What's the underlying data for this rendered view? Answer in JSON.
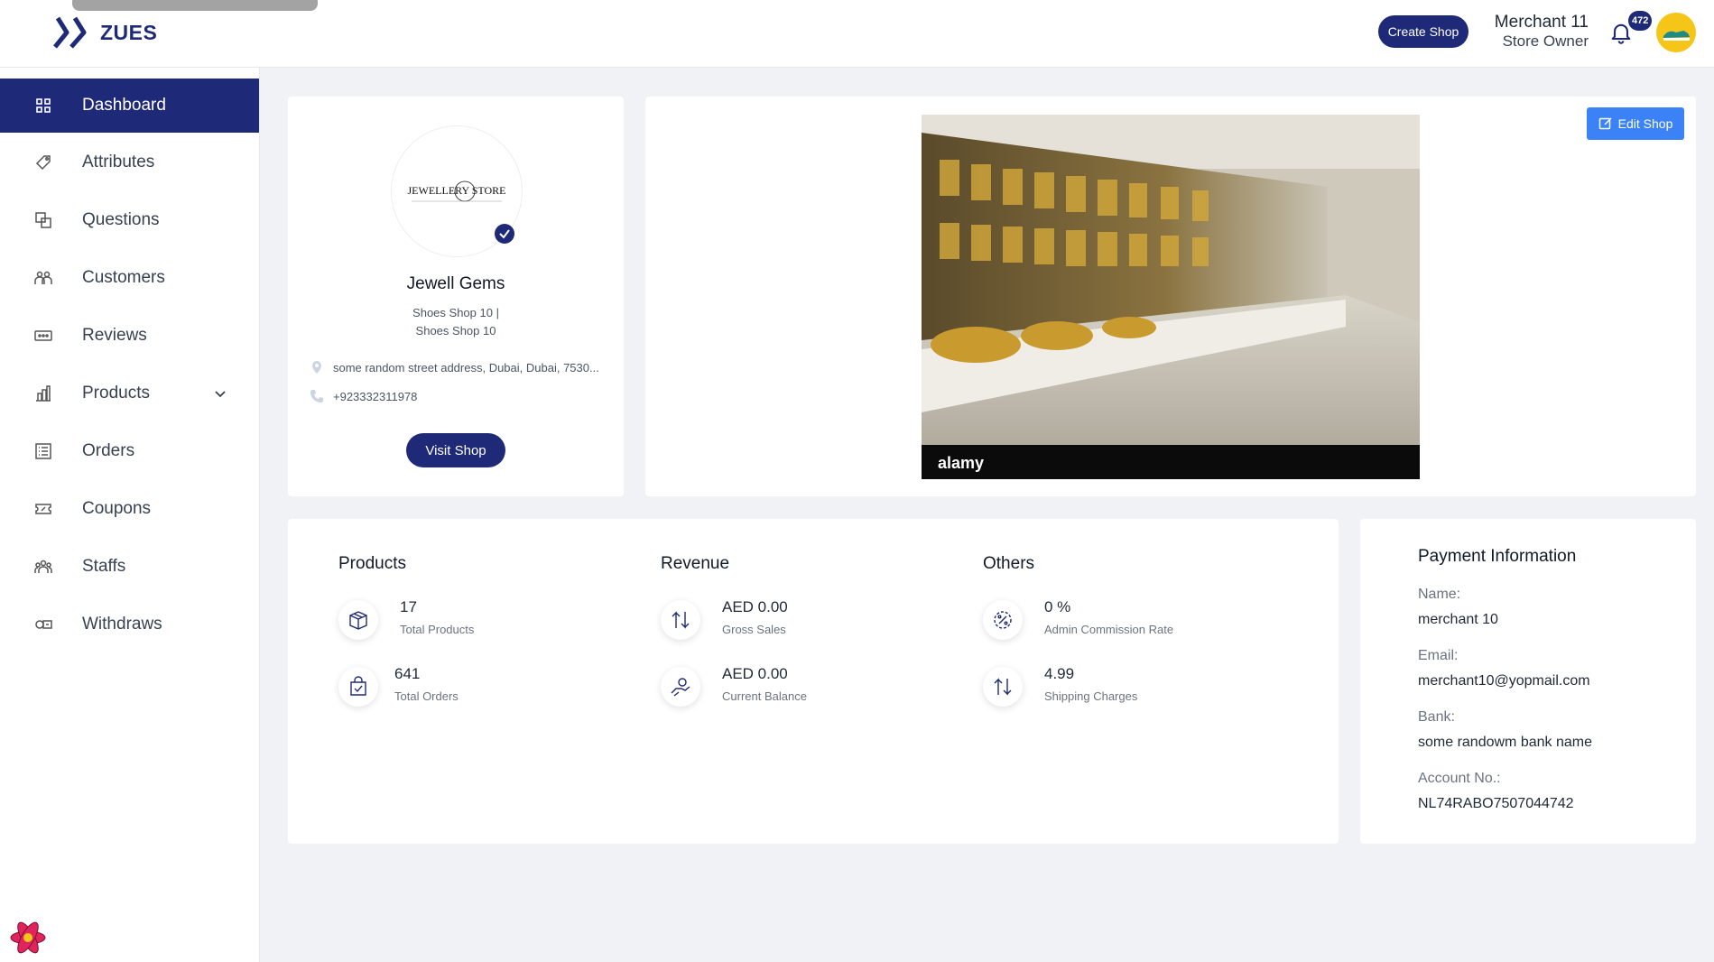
{
  "brand": {
    "name": "ZUES"
  },
  "header": {
    "create_shop_label": "Create Shop",
    "user_name": "Merchant 11",
    "user_role": "Store Owner",
    "notification_count": "472"
  },
  "sidebar": {
    "items": [
      {
        "label": "Dashboard",
        "icon": "grid-icon",
        "active": true
      },
      {
        "label": "Attributes",
        "icon": "tag-icon"
      },
      {
        "label": "Questions",
        "icon": "questions-icon"
      },
      {
        "label": "Customers",
        "icon": "customers-icon"
      },
      {
        "label": "Reviews",
        "icon": "reviews-icon"
      },
      {
        "label": "Products",
        "icon": "products-icon",
        "expandable": true
      },
      {
        "label": "Orders",
        "icon": "orders-icon"
      },
      {
        "label": "Coupons",
        "icon": "coupons-icon"
      },
      {
        "label": "Staffs",
        "icon": "staffs-icon"
      },
      {
        "label": "Withdraws",
        "icon": "withdraws-icon"
      }
    ]
  },
  "shop": {
    "logo_text": "JEWELLERY STORE",
    "name": "Jewell Gems",
    "category_line1": "Shoes Shop 10 |",
    "category_line2": "Shoes Shop 10",
    "address": "some random street address, Dubai, Dubai, 7530...",
    "phone": "+923332311978",
    "visit_label": "Visit Shop",
    "edit_label": "Edit Shop",
    "image_watermark": "alamy"
  },
  "stats": {
    "products": {
      "title": "Products",
      "total_products_value": "17",
      "total_products_label": "Total Products",
      "total_orders_value": "641",
      "total_orders_label": "Total Orders"
    },
    "revenue": {
      "title": "Revenue",
      "gross_sales_value": "AED 0.00",
      "gross_sales_label": "Gross Sales",
      "current_balance_value": "AED 0.00",
      "current_balance_label": "Current Balance"
    },
    "others": {
      "title": "Others",
      "commission_value": "0 %",
      "commission_label": "Admin Commission Rate",
      "shipping_value": "4.99",
      "shipping_label": "Shipping Charges"
    }
  },
  "payment": {
    "title": "Payment Information",
    "name_label": "Name:",
    "name_value": "merchant 10",
    "email_label": "Email:",
    "email_value": "merchant10@yopmail.com",
    "bank_label": "Bank:",
    "bank_value": "some randowm bank name",
    "account_label": "Account No.:",
    "account_value": "NL74RABO7507044742"
  },
  "colors": {
    "primary": "#1e2a78",
    "accent": "#3b82f6",
    "background": "#f1f2f6"
  }
}
